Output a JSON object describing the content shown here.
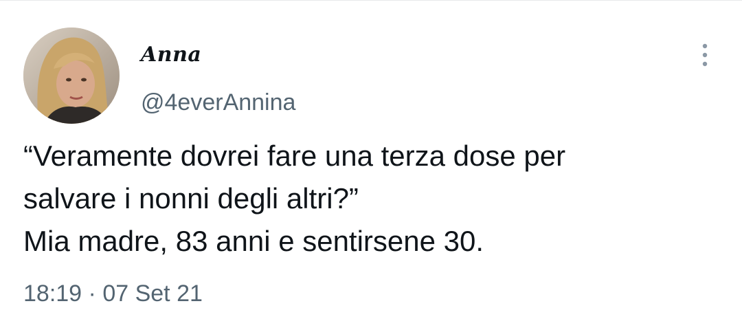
{
  "tweet": {
    "author": {
      "display_name": "Anna",
      "handle": "@4everAnnina",
      "avatar_icon": "profile-photo"
    },
    "text_lines": [
      "“Veramente dovrei fare una terza dose per",
      "salvare i nonni degli altri?”",
      "Mia madre, 83 anni e sentirsene 30."
    ],
    "time": "18:19",
    "separator": "·",
    "date": "07 Set 21",
    "more_icon": "more-vertical-icon"
  },
  "colors": {
    "primary_text": "#0f1419",
    "secondary_text": "#536471",
    "divider": "#e7e9ea",
    "background": "#ffffff"
  }
}
